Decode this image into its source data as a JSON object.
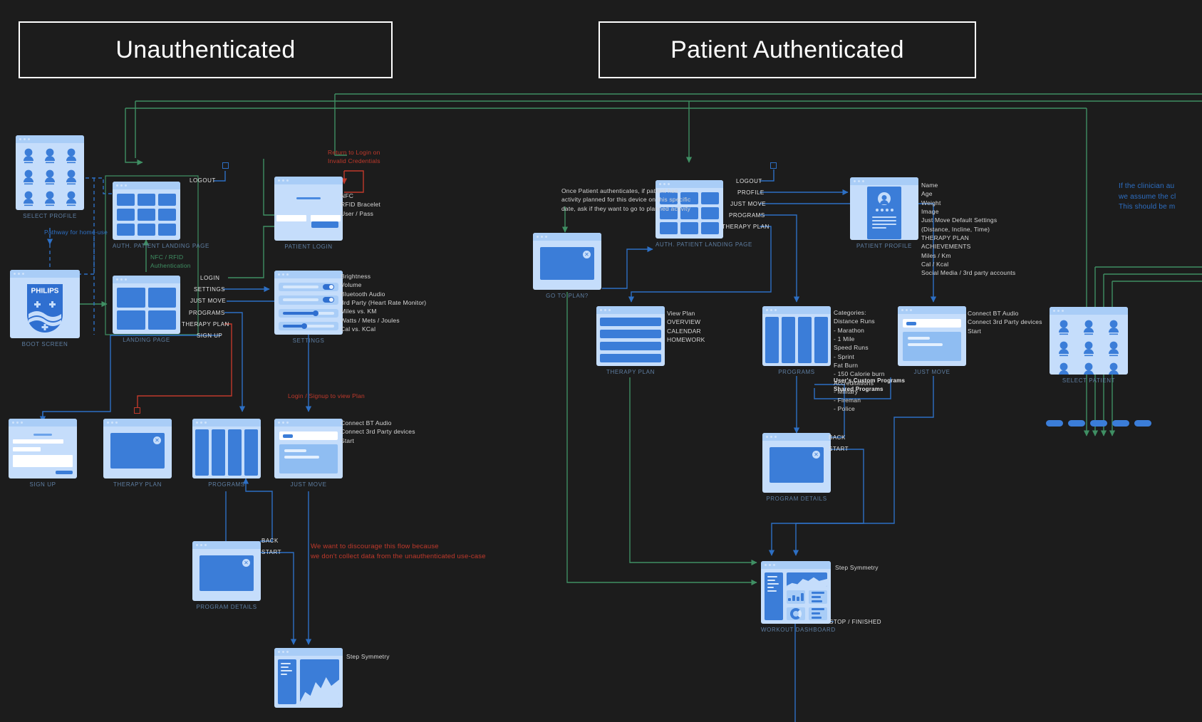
{
  "banners": [
    {
      "id": "unauthenticated",
      "label": "Unauthenticated"
    },
    {
      "id": "patient-authenticated",
      "label": "Patient Authenticated"
    }
  ],
  "colors": {
    "background": "#1c1c1c",
    "screen_fill": "#c5ddfb",
    "tile_blue": "#3b7dd8",
    "caption": "#5f7fa3",
    "flow_blue": "#2d6fc4",
    "flow_green": "#3f8f63",
    "flow_red": "#c0392b",
    "banner_text": "#ffffff"
  },
  "screens": {
    "select_profile": {
      "caption": "SELECT PROFILE"
    },
    "boot_screen": {
      "caption": "BOOT SCREEN",
      "logo": "PHILIPS"
    },
    "auth_patient_landing": {
      "caption": "AUTH. PATIENT LANDING PAGE"
    },
    "landing_page": {
      "caption": "LANDING PAGE"
    },
    "patient_login": {
      "caption": "PATIENT LOGIN"
    },
    "settings": {
      "caption": "SETTINGS"
    },
    "sign_up": {
      "caption": "SIGN UP"
    },
    "therapy_plan_unauth": {
      "caption": "THERAPY PLAN"
    },
    "programs_unauth": {
      "caption": "PROGRAMS"
    },
    "just_move_unauth": {
      "caption": "JUST MOVE"
    },
    "program_details_unauth": {
      "caption": "PROGRAM DETAILS"
    },
    "go_to_plan": {
      "caption": "GO TO PLAN?"
    },
    "auth_patient_landing_2": {
      "caption": "AUTH. PATIENT LANDING PAGE"
    },
    "patient_profile": {
      "caption": "PATIENT PROFILE"
    },
    "therapy_plan_auth": {
      "caption": "THERAPY PLAN"
    },
    "programs_auth": {
      "caption": "PROGRAMS"
    },
    "just_move_auth": {
      "caption": "JUST MOVE"
    },
    "select_patient": {
      "caption": "SELECT PATIENT"
    },
    "program_details_auth": {
      "caption": "PROGRAM DETAILS"
    },
    "workout_dashboard": {
      "caption": "WORKOUT DASHBOARD"
    }
  },
  "edge_labels": {
    "logout_unauth": "LOGOUT",
    "login": "LOGIN",
    "settings": "SETTINGS",
    "just_move": "JUST MOVE",
    "programs": "PROGRAMS",
    "therapy_plan": "THERAPY PLAN",
    "sign_up": "SIGN UP",
    "back_unauth": "BACK",
    "start_unauth": "START",
    "logout_auth": "LOGOUT",
    "profile_auth": "PROFILE",
    "just_move_auth": "JUST MOVE",
    "programs_auth": "PROGRAMS",
    "therapy_plan_auth": "THERAPY PLAN",
    "back_auth": "BACK",
    "start_auth": "START",
    "stop_finished": "STOP / FINISHED"
  },
  "annotations": {
    "pathway_home_use": "Pathway for home-use",
    "nfc_rfid_auth": "NFC / RFID\nAuthentication",
    "return_invalid_credentials": "Return to Login on\nInvalid Credentials",
    "login_methods": "NFC\nRFID Bracelet\nUser / Pass",
    "settings_options": "Brightness\nVolume\nBluetooth Audio\n3rd Party (Heart Rate Monitor)\nMiles vs. KM\nWatts / Mets / Joules\nCal vs. KCal",
    "just_move_options_unauth": "Connect BT Audio\nConnect 3rd Party devices\nStart",
    "login_signup_to_view_plan": "Login / Signup to view Plan",
    "discourage_flow": "We want to discourage this flow because\nwe don't collect data from the unauthenticated use-case",
    "step_symmetry_unauth": "Step Symmetry",
    "once_patient_authenticates": "Once Patient authenticates, if patient has\nactivity planned for this device on this specific\ndate,  ask if they want to go to planned activity",
    "patient_profile_fields": "Name\nAge\nWeight\nImage\nJust Move Default Settings\n        (Distance, Incline, Time)\nTHERAPY PLAN\nACHIEVEMENTS\nMiles / Km\nCal / Kcal\nSocial Media / 3rd party accounts",
    "therapy_plan_options": "View Plan\nOVERVIEW\nCALENDAR\nHOMEWORK",
    "program_categories": "Categories:\nDistance Runs\n- Marathon\n- 1 Mile\nSpeed Runs\n- Sprint\nFat Burn\n- 150 Calorie burn\nAccreditations\n- Military\n- Fireman\n- Police",
    "program_categories_bold": "User's Custom Programs\nShared Programs",
    "just_move_options_auth": "Connect BT Audio\nConnect 3rd Party devices\nStart",
    "clinician_note": "If the clinician au\nwe assume the cl\nThis should be m",
    "step_symmetry_auth": "Step Symmetry"
  }
}
